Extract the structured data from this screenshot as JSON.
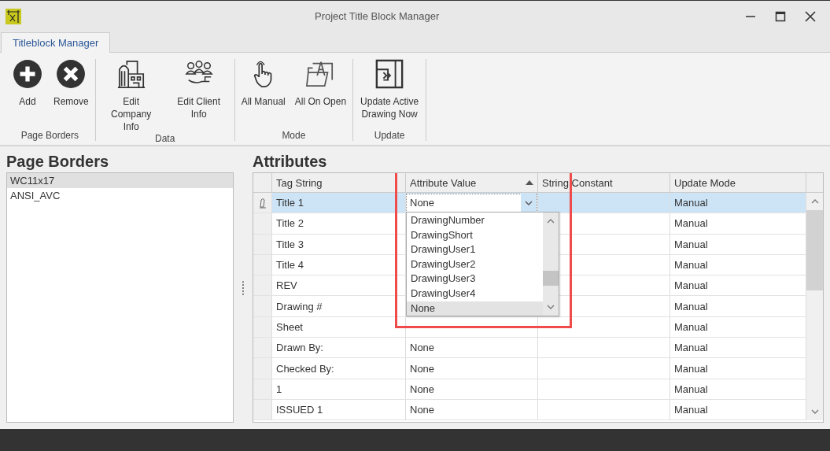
{
  "window": {
    "title": "Project Title Block Manager"
  },
  "tabs": [
    {
      "label": "Titleblock Manager",
      "selected": true
    }
  ],
  "ribbon_groups": [
    {
      "label": "Page Borders",
      "buttons": [
        {
          "kind": "add",
          "label": "Add"
        },
        {
          "kind": "remove",
          "label": "Remove"
        }
      ]
    },
    {
      "label": "Data",
      "buttons": [
        {
          "kind": "company",
          "label": "Edit Company Info"
        },
        {
          "kind": "client",
          "label": "Edit Client Info"
        }
      ]
    },
    {
      "label": "Mode",
      "buttons": [
        {
          "kind": "manual",
          "label": "All Manual"
        },
        {
          "kind": "open",
          "label": "All On Open"
        }
      ]
    },
    {
      "label": "Update",
      "buttons": [
        {
          "kind": "update",
          "label": "Update Active Drawing Now"
        }
      ]
    }
  ],
  "page_borders": {
    "heading": "Page Borders",
    "items": [
      {
        "label": "WC11x17",
        "selected": true
      },
      {
        "label": "ANSI_AVC",
        "selected": false
      }
    ]
  },
  "attributes": {
    "heading": "Attributes",
    "highlight_frame": true,
    "columns": [
      {
        "label": "Tag String"
      },
      {
        "label": "Attribute Value",
        "sorted_ascending": true
      },
      {
        "label": "String Constant"
      },
      {
        "label": "Update Mode"
      }
    ],
    "rows": [
      {
        "tag": "Title 1",
        "value": "None",
        "mode": "Manual",
        "selected": true
      },
      {
        "tag": "Title 2",
        "mode": "Manual",
        "selected": false
      },
      {
        "tag": "Title 3",
        "mode": "Manual",
        "selected": false
      },
      {
        "tag": "Title 4",
        "mode": "Manual",
        "selected": false
      },
      {
        "tag": "REV",
        "mode": "Manual",
        "selected": false
      },
      {
        "tag": "Drawing #",
        "mode": "Manual",
        "selected": false
      },
      {
        "tag": "Sheet",
        "mode": "Manual",
        "selected": false
      },
      {
        "tag": "Drawn By:",
        "value": "None",
        "mode": "Manual",
        "selected": false
      },
      {
        "tag": "Checked By:",
        "value": "None",
        "mode": "Manual",
        "selected": false
      },
      {
        "tag": "1",
        "value": "None",
        "mode": "Manual",
        "selected": false
      },
      {
        "tag": "ISSUED 1",
        "value": "None",
        "mode": "Manual",
        "selected": false
      }
    ],
    "dropdown": {
      "options": [
        {
          "label": "DrawingNumber",
          "selected": false
        },
        {
          "label": "DrawingShort",
          "selected": false
        },
        {
          "label": "DrawingUser1",
          "selected": false
        },
        {
          "label": "DrawingUser2",
          "selected": false
        },
        {
          "label": "DrawingUser3",
          "selected": false
        },
        {
          "label": "DrawingUser4",
          "selected": false
        },
        {
          "label": "None",
          "selected": true
        }
      ]
    }
  }
}
